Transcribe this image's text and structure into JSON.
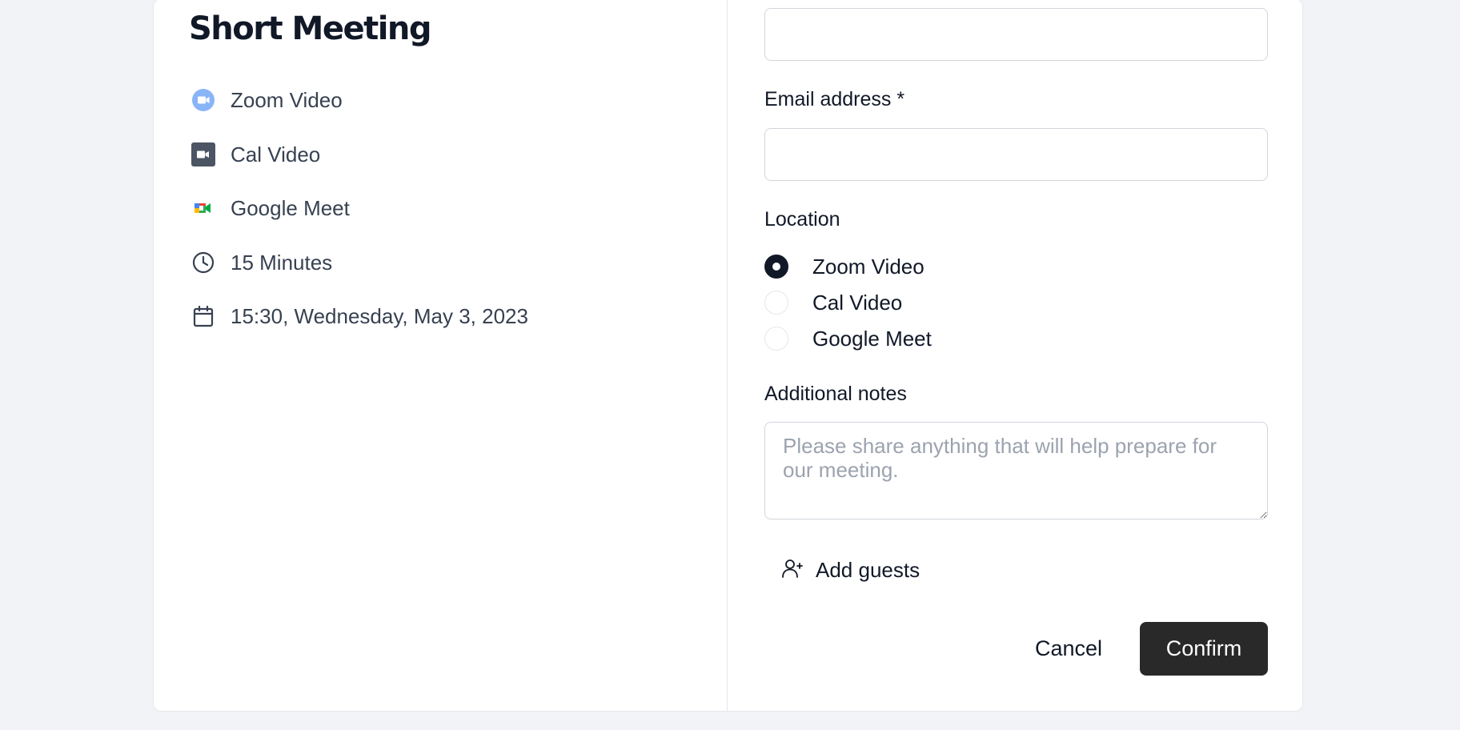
{
  "event": {
    "title": "Short Meeting",
    "details": [
      {
        "icon": "zoom-video-icon",
        "label": "Zoom Video"
      },
      {
        "icon": "cal-video-icon",
        "label": "Cal Video"
      },
      {
        "icon": "google-meet-icon",
        "label": "Google Meet"
      },
      {
        "icon": "clock-icon",
        "label": "15 Minutes"
      },
      {
        "icon": "calendar-icon",
        "label": "15:30, Wednesday, May 3, 2023"
      }
    ]
  },
  "form": {
    "name_value": "",
    "email": {
      "label": "Email address *",
      "value": ""
    },
    "location": {
      "label": "Location",
      "options": [
        {
          "label": "Zoom Video",
          "checked": true
        },
        {
          "label": "Cal Video",
          "checked": false
        },
        {
          "label": "Google Meet",
          "checked": false
        }
      ]
    },
    "notes": {
      "label": "Additional notes",
      "placeholder": "Please share anything that will help prepare for our meeting."
    },
    "add_guests_label": "Add guests",
    "cancel_label": "Cancel",
    "confirm_label": "Confirm"
  },
  "colors": {
    "background": "#f2f3f6",
    "primary_button": "#292929",
    "zoom_blue": "#2d8cff",
    "cal_gray": "#4b5563"
  }
}
